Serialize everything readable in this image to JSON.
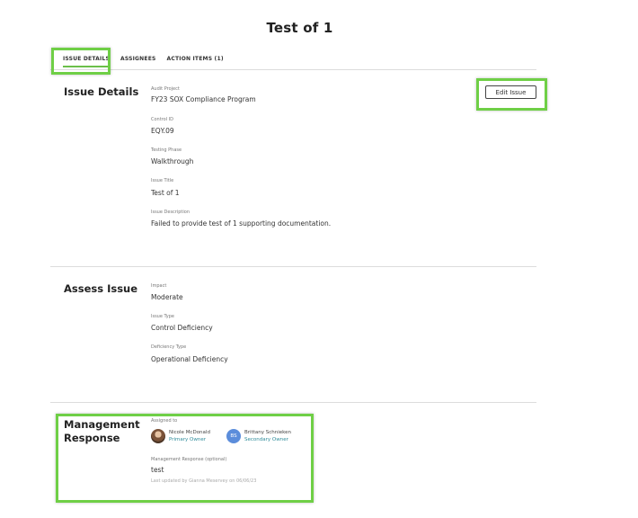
{
  "page": {
    "title": "Test of 1"
  },
  "tabs": [
    {
      "label": "ISSUE DETAILS",
      "active": true
    },
    {
      "label": "ASSIGNEES",
      "active": false
    },
    {
      "label": "ACTION ITEMS (1)",
      "active": false
    }
  ],
  "issue_details": {
    "title": "Issue Details",
    "edit_label": "Edit Issue",
    "fields": [
      {
        "label": "Audit Project",
        "value": "FY23 SOX Compliance Program"
      },
      {
        "label": "Control ID",
        "value": "EQY.09"
      },
      {
        "label": "Testing Phase",
        "value": "Walkthrough"
      },
      {
        "label": "Issue Title",
        "value": "Test of 1"
      },
      {
        "label": "Issue Description",
        "value": "Failed to provide test of 1 supporting documentation."
      }
    ]
  },
  "assess_issue": {
    "title": "Assess Issue",
    "fields": [
      {
        "label": "Impact",
        "value": "Moderate"
      },
      {
        "label": "Issue Type",
        "value": "Control Deficiency"
      },
      {
        "label": "Deficiency Type",
        "value": "Operational Deficiency"
      }
    ]
  },
  "management_response": {
    "title_line1": "Management",
    "title_line2": "Response",
    "assigned_label": "Assigned to",
    "assignees": [
      {
        "name": "Nicole McDonald",
        "role": "Primary Owner",
        "avatar": "photo"
      },
      {
        "name": "Brittany Schnieken",
        "role": "Secondary Owner",
        "initials": "BS"
      }
    ],
    "response_label": "Management Response (optional)",
    "response_value": "test",
    "last_updated": "Last updated by Gianna Meservey on 06/06/23"
  },
  "colors": {
    "highlight": "#6fcf46",
    "accent_link": "#2e8b9a",
    "initials_avatar": "#5b8ddb"
  }
}
